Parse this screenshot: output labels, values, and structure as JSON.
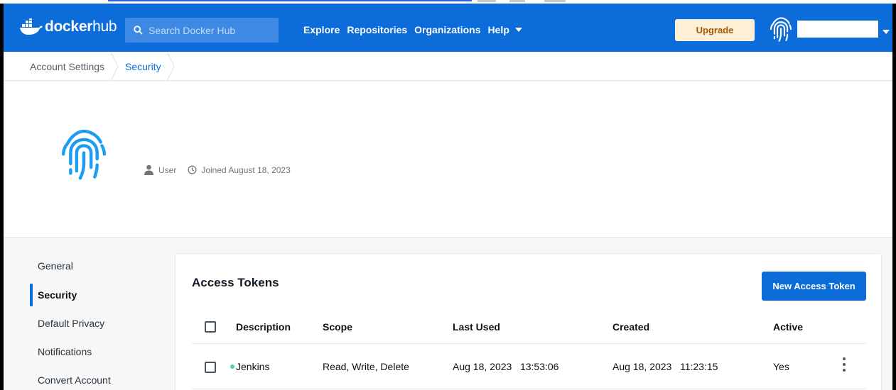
{
  "header": {
    "logo_text_bold": "docker",
    "logo_text_light": "hub",
    "search_placeholder": "Search Docker Hub",
    "nav": [
      "Explore",
      "Repositories",
      "Organizations",
      "Help"
    ],
    "upgrade_label": "Upgrade"
  },
  "breadcrumb": [
    "Account Settings",
    "Security"
  ],
  "profile": {
    "role": "User",
    "joined": "Joined August 18, 2023"
  },
  "sidebar": {
    "items": [
      "General",
      "Security",
      "Default Privacy",
      "Notifications",
      "Convert Account"
    ],
    "active": "Security"
  },
  "tokens": {
    "title": "Access Tokens",
    "new_button": "New Access Token",
    "columns": [
      "Description",
      "Scope",
      "Last Used",
      "Created",
      "Active"
    ],
    "rows": [
      {
        "description": "Jenkins",
        "scope": "Read, Write, Delete",
        "last_used": "Aug 18, 2023   13:53:06",
        "created": "Aug 18, 2023   11:23:15",
        "active": "Yes"
      }
    ]
  },
  "colors": {
    "brand_blue": "#0b6cda",
    "upgrade_bg": "#fdf0d7",
    "status_green": "#4fd1a5"
  }
}
